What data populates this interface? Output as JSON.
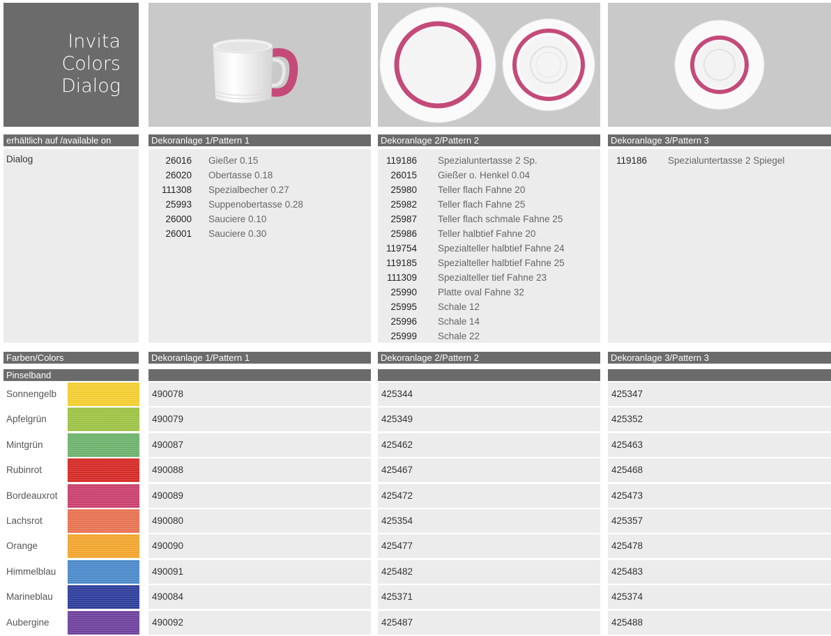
{
  "title": {
    "line1": "Invita",
    "line2": "Colors",
    "line3": "Dialog"
  },
  "headers_top": {
    "available": "erhältlich auf  /available on",
    "p1": "Dekoranlage 1/Pattern 1",
    "p2": "Dekoranlage 2/Pattern 2",
    "p3": "Dekoranlage 3/Pattern 3"
  },
  "available_series": "Dialog",
  "pattern1_items": [
    {
      "no": "26016",
      "desc": "Gießer 0.15"
    },
    {
      "no": "26020",
      "desc": "Obertasse 0.18"
    },
    {
      "no": "111308",
      "desc": "Spezialbecher 0.27"
    },
    {
      "no": "25993",
      "desc": "Suppenobertasse 0.28"
    },
    {
      "no": "26000",
      "desc": "Sauciere 0.10"
    },
    {
      "no": "26001",
      "desc": "Sauciere 0.30"
    }
  ],
  "pattern2_items": [
    {
      "no": "119186",
      "desc": "Spezialuntertasse 2 Sp."
    },
    {
      "no": "26015",
      "desc": "Gießer o. Henkel 0.04"
    },
    {
      "no": "25980",
      "desc": "Teller flach Fahne 20"
    },
    {
      "no": "25982",
      "desc": "Teller flach Fahne 25"
    },
    {
      "no": "25987",
      "desc": "Teller flach schmale Fahne 25"
    },
    {
      "no": "25986",
      "desc": "Teller halbtief Fahne 20"
    },
    {
      "no": "119754",
      "desc": "Spezialteller halbtief Fahne 24"
    },
    {
      "no": "119185",
      "desc": "Spezialteller halbtief Fahne 25"
    },
    {
      "no": "111309",
      "desc": "Spezialteller tief Fahne 23"
    },
    {
      "no": "25990",
      "desc": "Platte oval Fahne 32"
    },
    {
      "no": "25995",
      "desc": "Schale 12"
    },
    {
      "no": "25996",
      "desc": "Schale 14"
    },
    {
      "no": "25999",
      "desc": "Schale 22"
    }
  ],
  "pattern3_items": [
    {
      "no": "119186",
      "desc": "Spezialuntertasse 2 Spiegel"
    }
  ],
  "headers_bottom": {
    "colors": "Farben/Colors",
    "p1": "Dekoranlage 1/Pattern 1",
    "p2": "Dekoranlage 2/Pattern 2",
    "p3": "Dekoranlage 3/Pattern 3"
  },
  "band_label": "Pinselband",
  "colors": [
    {
      "name": "Sonnengelb",
      "hex": "#f7cf2a",
      "p1": "490078",
      "p2": "425344",
      "p3": "425347"
    },
    {
      "name": "Apfelgrün",
      "hex": "#9cc43e",
      "p1": "490079",
      "p2": "425349",
      "p3": "425352"
    },
    {
      "name": "Mintgrün",
      "hex": "#6ab36a",
      "p1": "490087",
      "p2": "425462",
      "p3": "425463"
    },
    {
      "name": "Rubinrot",
      "hex": "#d8231f",
      "p1": "490088",
      "p2": "425467",
      "p3": "425468"
    },
    {
      "name": "Bordeauxrot",
      "hex": "#cc3a6a",
      "p1": "490089",
      "p2": "425472",
      "p3": "425473"
    },
    {
      "name": "Lachsrot",
      "hex": "#ea6f4c",
      "p1": "490080",
      "p2": "425354",
      "p3": "425357"
    },
    {
      "name": "Orange",
      "hex": "#f6a527",
      "p1": "490090",
      "p2": "425477",
      "p3": "425478"
    },
    {
      "name": "Himmelblau",
      "hex": "#4688cc",
      "p1": "490091",
      "p2": "425482",
      "p3": "425483"
    },
    {
      "name": "Marineblau",
      "hex": "#27379a",
      "p1": "490084",
      "p2": "425371",
      "p3": "425374"
    },
    {
      "name": "Aubergine",
      "hex": "#6a3c9c",
      "p1": "490092",
      "p2": "425487",
      "p3": "425488"
    }
  ],
  "accent_color": "#c44a7a"
}
